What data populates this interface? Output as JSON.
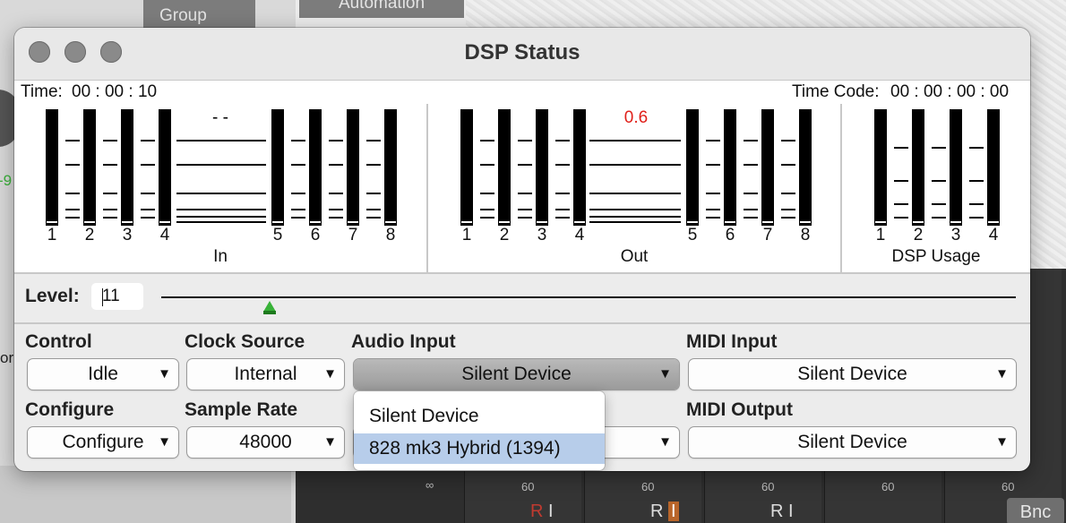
{
  "background": {
    "tabs": [
      "Group",
      "Automation"
    ],
    "strip_scale_label": "60",
    "infinity": "∞",
    "strip_buttons": [
      {
        "r": "R",
        "i": "I"
      },
      {
        "r": "R",
        "i": "I"
      },
      {
        "r": "R",
        "i": "I"
      }
    ],
    "bounce_button": "Bnc",
    "left_edge_text": [
      "-9",
      "or"
    ]
  },
  "window": {
    "title": "DSP Status",
    "time_label": "Time:",
    "time_value": "00 : 00 : 10",
    "timecode_label": "Time Code:",
    "timecode_value": "00 : 00 : 00 : 00"
  },
  "meters": {
    "in": {
      "caption": "In",
      "peak": "- -",
      "channels": [
        "1",
        "2",
        "3",
        "4",
        "5",
        "6",
        "7",
        "8"
      ]
    },
    "out": {
      "caption": "Out",
      "peak": "0.6",
      "channels": [
        "1",
        "2",
        "3",
        "4",
        "5",
        "6",
        "7",
        "8"
      ]
    },
    "dsp": {
      "caption": "DSP Usage",
      "channels": [
        "1",
        "2",
        "3",
        "4"
      ]
    },
    "peak_color": "#e0201a"
  },
  "level": {
    "label": "Level:",
    "value": "11",
    "slider_fraction": 0.11
  },
  "controls": {
    "control": {
      "label": "Control",
      "value": "Idle"
    },
    "clock_source": {
      "label": "Clock Source",
      "value": "Internal"
    },
    "audio_input": {
      "label": "Audio Input",
      "value": "Silent Device"
    },
    "midi_input": {
      "label": "MIDI Input",
      "value": "Silent Device"
    },
    "configure": {
      "label": "Configure",
      "value": "Configure"
    },
    "sample_rate": {
      "label": "Sample Rate",
      "value": "48000"
    },
    "midi_output": {
      "label": "MIDI Output",
      "value": "Silent Device"
    }
  },
  "dropdown": {
    "options": [
      "Silent Device",
      "828 mk3 Hybrid (1394)"
    ],
    "highlight_color": "#b7cdea"
  }
}
